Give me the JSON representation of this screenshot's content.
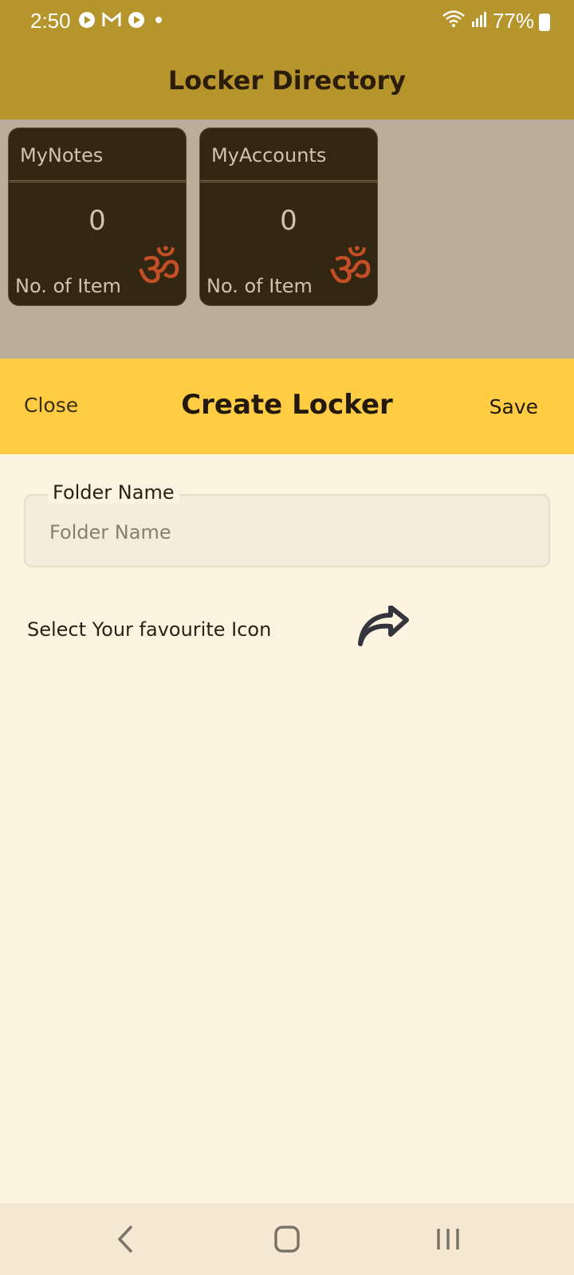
{
  "status_bar": {
    "time": "2:50",
    "battery": "77%"
  },
  "app_bar": {
    "title": "Locker Directory"
  },
  "lockers": [
    {
      "name": "MyNotes",
      "count": "0",
      "count_label": "No. of Item",
      "symbol": "ॐ"
    },
    {
      "name": "MyAccounts",
      "count": "0",
      "count_label": "No. of Item",
      "symbol": "ॐ"
    }
  ],
  "sheet": {
    "close_label": "Close",
    "title": "Create Locker",
    "save_label": "Save",
    "folder_field": {
      "label": "Folder Name",
      "placeholder": "Folder Name",
      "value": ""
    },
    "icon_select_label": "Select Your favourite Icon"
  },
  "colors": {
    "app_bar": "#B7952D",
    "sheet_header": "#FFCC44",
    "card_bg": "#322713",
    "om": "#C44E25"
  },
  "icons": {
    "status_left": [
      "play-icon",
      "gmail-icon",
      "play-icon",
      "dot-icon"
    ],
    "status_right": [
      "wifi-icon",
      "signal-icon",
      "battery-icon"
    ],
    "select_icon": "share-arrow-icon",
    "nav": [
      "back-icon",
      "home-icon",
      "recents-icon"
    ]
  }
}
